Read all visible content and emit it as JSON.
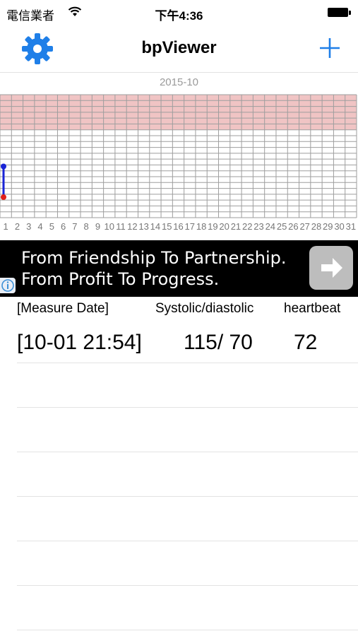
{
  "status_bar": {
    "carrier": "電信業者",
    "time": "下午4:36"
  },
  "nav": {
    "title": "bpViewer",
    "settings_icon": "gear-icon",
    "add_icon": "plus-icon",
    "accent_color": "#1f7fe8"
  },
  "chart_data": {
    "type": "line",
    "title": "2015-10",
    "categories": [
      "1",
      "2",
      "3",
      "4",
      "5",
      "6",
      "7",
      "8",
      "9",
      "10",
      "11",
      "12",
      "13",
      "14",
      "15",
      "16",
      "17",
      "18",
      "19",
      "20",
      "21",
      "22",
      "23",
      "24",
      "25",
      "26",
      "27",
      "28",
      "29",
      "30",
      "31"
    ],
    "series": [
      {
        "values": [
          115
        ]
      },
      {
        "values": [
          70
        ]
      }
    ],
    "highlight_band": {
      "color": "#f0c4c4"
    },
    "grid": true
  },
  "ad": {
    "line1": "From Friendship To Partnership.",
    "line2": "From Profit To Progress.",
    "button_icon": "arrow-right-icon",
    "info_icon": "info-icon"
  },
  "table": {
    "headers": {
      "date": "[Measure Date]",
      "bp": "Systolic/diastolic",
      "heartbeat": "heartbeat"
    },
    "rows": [
      {
        "date": "[10-01 21:54]",
        "bp": "115/ 70",
        "heartbeat": "72"
      }
    ]
  }
}
